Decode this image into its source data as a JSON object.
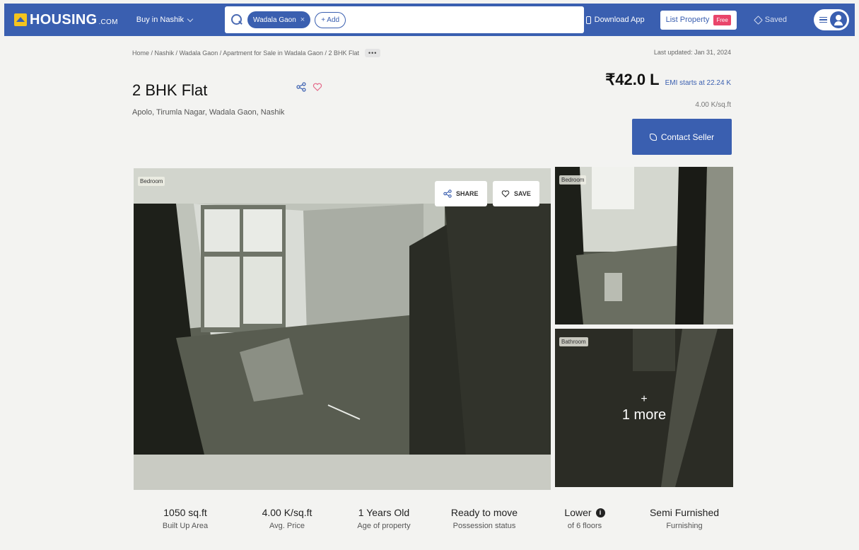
{
  "header": {
    "logo_text": "HOUSING",
    "logo_suffix": ".COM",
    "city_dropdown": "Buy in Nashik",
    "search_chip": "Wadala Gaon",
    "search_add": "+ Add",
    "download_app": "Download App",
    "list_property": "List Property",
    "free_badge": "Free",
    "saved": "Saved"
  },
  "breadcrumb": [
    "Home",
    "Nashik",
    "Wadala Gaon",
    "Apartment for Sale in Wadala Gaon",
    "2 BHK Flat"
  ],
  "breadcrumb_sep": " / ",
  "breadcrumb_text": "Home / Nashik / Wadala Gaon / Apartment for Sale in Wadala Gaon / 2 BHK Flat",
  "more_dots": "•••",
  "last_updated": "Last updated: Jan 31, 2024",
  "listing": {
    "title": "2 BHK Flat",
    "address": "Apolo, Tirumla Nagar, Wadala Gaon, Nashik",
    "price": "₹42.0 L",
    "emi": "EMI starts at  22.24 K",
    "price_per_sqft": "4.00 K/sq.ft",
    "contact_button": "Contact Seller"
  },
  "gallery": {
    "main_label": "Bedroom",
    "share_button": "SHARE",
    "save_button": "SAVE",
    "side1_label": "Bedroom",
    "side2_label": "Bathroom",
    "more_plus": "+",
    "more_text": "1 more"
  },
  "stats": [
    {
      "value": "1050 sq.ft",
      "label": "Built Up Area"
    },
    {
      "value": "4.00 K/sq.ft",
      "label": "Avg. Price"
    },
    {
      "value": "1 Years Old",
      "label": "Age of property"
    },
    {
      "value": "Ready to move",
      "label": "Possession status"
    },
    {
      "value": "Lower",
      "label": "of 6 floors"
    },
    {
      "value": "Semi Furnished",
      "label": "Furnishing"
    }
  ],
  "colors": {
    "brand": "#3a5fb0",
    "free_badge": "#e9456a",
    "logo_mark": "#f4c41e"
  }
}
